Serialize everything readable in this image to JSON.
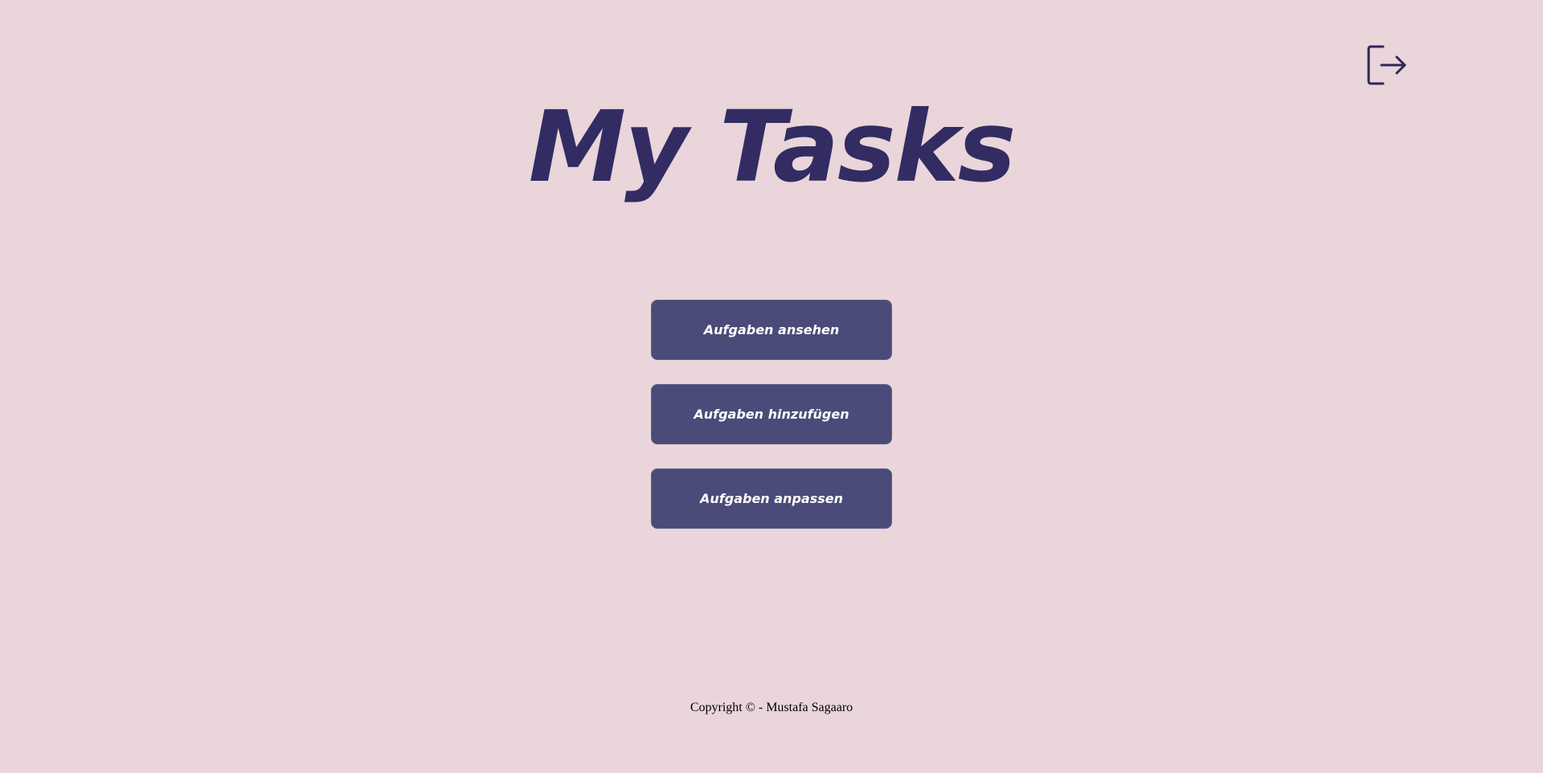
{
  "header": {
    "logout_icon": "logout-icon",
    "title": "My Tasks"
  },
  "menu": {
    "items": [
      {
        "label": "Aufgaben ansehen"
      },
      {
        "label": "Aufgaben hinzufügen"
      },
      {
        "label": "Aufgaben anpassen"
      }
    ]
  },
  "footer": {
    "copyright": "Copyright © - Mustafa Sagaaro"
  },
  "colors": {
    "background": "#e9d5da",
    "title": "#322c63",
    "button": "#4b4b79",
    "button_text": "#ffffff"
  }
}
